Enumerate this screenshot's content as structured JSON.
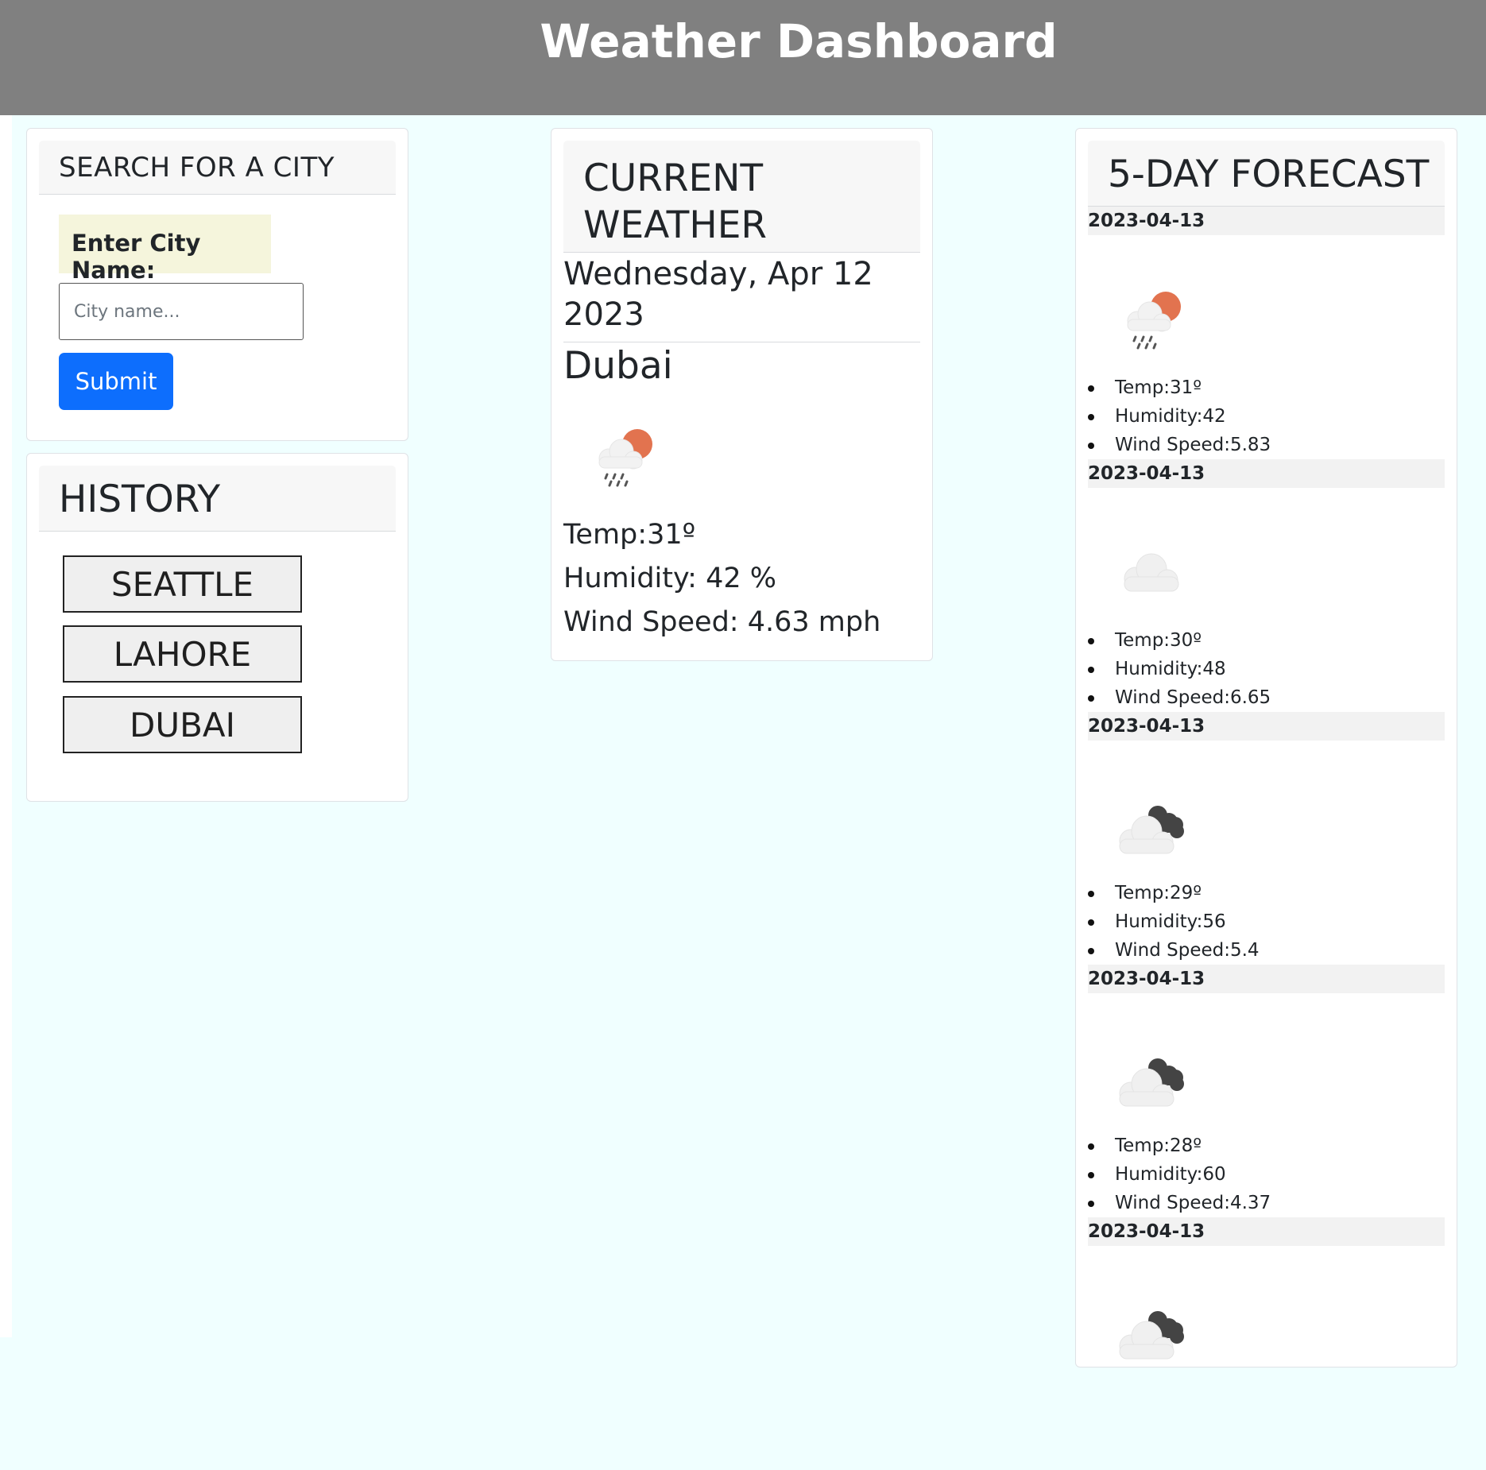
{
  "header": {
    "title": "Weather Dashboard"
  },
  "search": {
    "title": "SEARCH FOR A CITY",
    "label": "Enter City Name:",
    "placeholder": "City name...",
    "value": "",
    "submit_label": "Submit"
  },
  "history": {
    "title": "HISTORY",
    "cities": [
      "SEATTLE",
      "LAHORE",
      "DUBAI"
    ]
  },
  "current": {
    "title": "CURRENT WEATHER",
    "date": "Wednesday, Apr 12 2023",
    "city": "Dubai",
    "icon": "light-rain-sun-icon",
    "temp": "Temp:31º",
    "humidity": "Humidity: 42 %",
    "wind": "Wind Speed: 4.63 mph"
  },
  "forecast": {
    "title": "5-DAY FORECAST",
    "days": [
      {
        "date": "2023-04-13",
        "icon": "light-rain-sun-icon",
        "temp": "Temp:31º",
        "humidity": "Humidity:42",
        "wind": "Wind Speed:5.83"
      },
      {
        "date": "2023-04-13",
        "icon": "cloud-icon",
        "temp": "Temp:30º",
        "humidity": "Humidity:48",
        "wind": "Wind Speed:6.65"
      },
      {
        "date": "2023-04-13",
        "icon": "broken-clouds-icon",
        "temp": "Temp:29º",
        "humidity": "Humidity:56",
        "wind": "Wind Speed:5.4"
      },
      {
        "date": "2023-04-13",
        "icon": "broken-clouds-icon",
        "temp": "Temp:28º",
        "humidity": "Humidity:60",
        "wind": "Wind Speed:4.37"
      },
      {
        "date": "2023-04-13",
        "icon": "broken-clouds-icon"
      }
    ]
  },
  "colors": {
    "header_bg": "#808080",
    "page_bg": "#f0ffff",
    "submit_bg": "#0d6efd",
    "label_bg": "#f5f5dc",
    "sun": "#e2734f"
  }
}
